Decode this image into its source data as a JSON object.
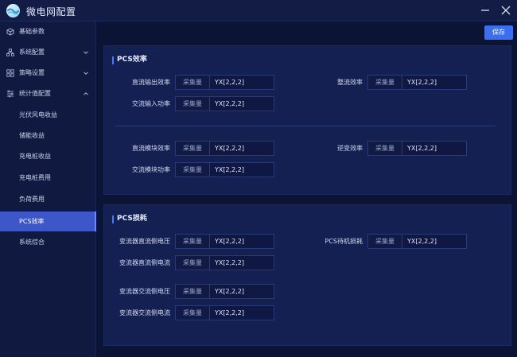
{
  "app": {
    "title": "微电网配置",
    "logo_icon": "wave-logo-icon"
  },
  "colors": {
    "accent": "#3a6ff0",
    "active_nav": "#3d56c8",
    "background": "#0b1334",
    "card": "#142051"
  },
  "sidebar": {
    "items": [
      {
        "label": "基础参数",
        "icon": "cube-icon"
      },
      {
        "label": "系统配置",
        "icon": "network-icon",
        "expandable": true
      },
      {
        "label": "策略设置",
        "icon": "grid-icon",
        "expandable": true
      },
      {
        "label": "统计值配置",
        "icon": "settings-list-icon",
        "expandable": true,
        "expanded": true
      }
    ],
    "sub_items": [
      {
        "label": "光伏风电收益"
      },
      {
        "label": "储能收益"
      },
      {
        "label": "充电桩收益"
      },
      {
        "label": "充电桩费用"
      },
      {
        "label": "负荷费用"
      },
      {
        "label": "PCS效率",
        "active": true
      },
      {
        "label": "系统综合"
      }
    ]
  },
  "toolbar": {
    "save_label": "保存"
  },
  "sections": [
    {
      "title": "PCS效率",
      "rows": [
        {
          "label": "直流输出效率",
          "tag": "采集量",
          "value": "YX[2,2,2]"
        },
        {
          "label": "整流效率",
          "tag": "采集量",
          "value": "YX[2,2,2]"
        },
        {
          "label": "交流输入功率",
          "tag": "采集量",
          "value": "YX[2,2,2]"
        },
        {
          "label": "直流模块效率",
          "tag": "采集量",
          "value": "YX[2,2,2]"
        },
        {
          "label": "逆变效率",
          "tag": "采集量",
          "value": "YX[2,2,2]"
        },
        {
          "label": "交流模块功率",
          "tag": "采集量",
          "value": "YX[2,2,2]"
        }
      ]
    },
    {
      "title": "PCS损耗",
      "rows": [
        {
          "label": "变流器直流侧电压",
          "tag": "采集量",
          "value": "YX[2,2,2]"
        },
        {
          "label": "PCS待机损耗",
          "tag": "采集量",
          "value": "YX[2,2,2]"
        },
        {
          "label": "变流器直流侧电流",
          "tag": "采集量",
          "value": "YX[2,2,2]"
        },
        {
          "label": "变流器交流侧电压",
          "tag": "采集量",
          "value": "YX[2,2,2]"
        },
        {
          "label": "变流器交流侧电流",
          "tag": "采集量",
          "value": "YX[2,2,2]"
        }
      ]
    }
  ]
}
